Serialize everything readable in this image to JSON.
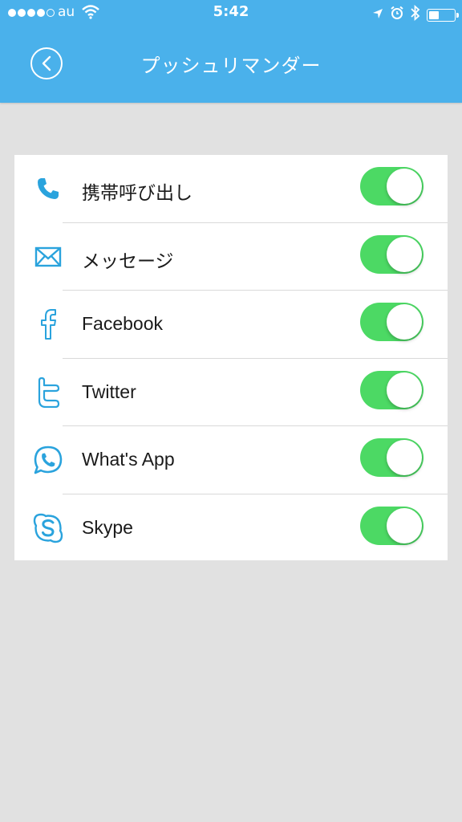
{
  "status_bar": {
    "carrier": "au",
    "time": "5:42"
  },
  "header": {
    "title": "プッシュリマンダー"
  },
  "colors": {
    "header_bg": "#4ab1eb",
    "icon": "#2aa3dd",
    "toggle_on": "#4cd964",
    "background": "#e1e1e1"
  },
  "items": [
    {
      "label": "携帯呼び出し",
      "icon": "phone-icon",
      "enabled": true
    },
    {
      "label": "メッセージ",
      "icon": "mail-icon",
      "enabled": true
    },
    {
      "label": "Facebook",
      "icon": "facebook-icon",
      "enabled": true
    },
    {
      "label": "Twitter",
      "icon": "twitter-icon",
      "enabled": true
    },
    {
      "label": "What's App",
      "icon": "whatsapp-icon",
      "enabled": true
    },
    {
      "label": "Skype",
      "icon": "skype-icon",
      "enabled": true
    }
  ]
}
